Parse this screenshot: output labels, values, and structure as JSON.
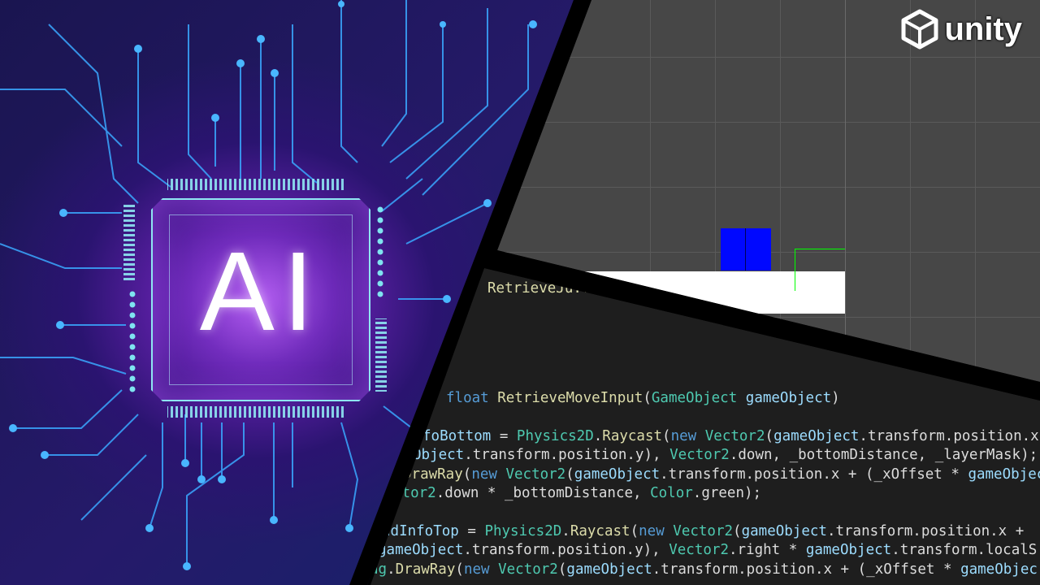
{
  "left_art": {
    "chip_label": "AI"
  },
  "brand": {
    "name": "unity",
    "logo_icon": "unity-cube-icon"
  },
  "scene": {
    "background": "#474747",
    "ground_color": "#ffffff",
    "player_color": "#0008ff",
    "ray_color": "#00ff00"
  },
  "code": {
    "lines": [
      "RetrieveJu...",
      "float RetrieveMoveInput(GameObject gameObject)",
      "foBottom = Physics2D.Raycast(new Vector2(gameObject.transform.position.x",
      "Object.transform.position.y), Vector2.down, _bottomDistance, _layerMask);",
      "DrawRay(new Vector2(gameObject.transform.position.x + (_xOffset * gameObjec",
      "ctor2.down * _bottomDistance, Color.green);",
      "ndInfoTop = Physics2D.Raycast(new Vector2(gameObject.transform.position.x +",
      "gameObject.transform.position.y), Vector2.right * gameObject.transform.localS",
      "ug.DrawRay(new Vector2(gameObject.transform.position.x + (_xOffset * gameObjec"
    ]
  }
}
